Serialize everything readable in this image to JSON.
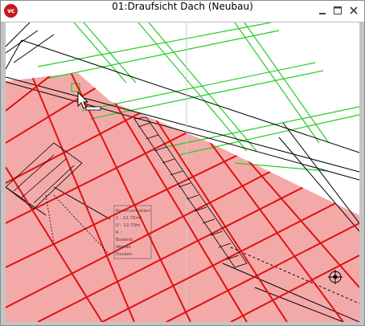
{
  "window": {
    "title": "01:Draufsicht Dach (Neubau)",
    "logo_text": "vc",
    "controls": [
      "minimize-icon",
      "maximize-icon",
      "close-icon"
    ]
  },
  "drawing": {
    "room_stamp": {
      "lines": [
        "Kommunikation",
        "1 : 12.75m²",
        "U : 12.70m",
        "R :",
        "Bodenb",
        "Wände",
        "Decken"
      ]
    },
    "colors": {
      "roof_fill": "#f4a9a9",
      "rafter_red": "#e01010",
      "green_grid": "#22cc22",
      "black_lines": "#000000"
    }
  }
}
